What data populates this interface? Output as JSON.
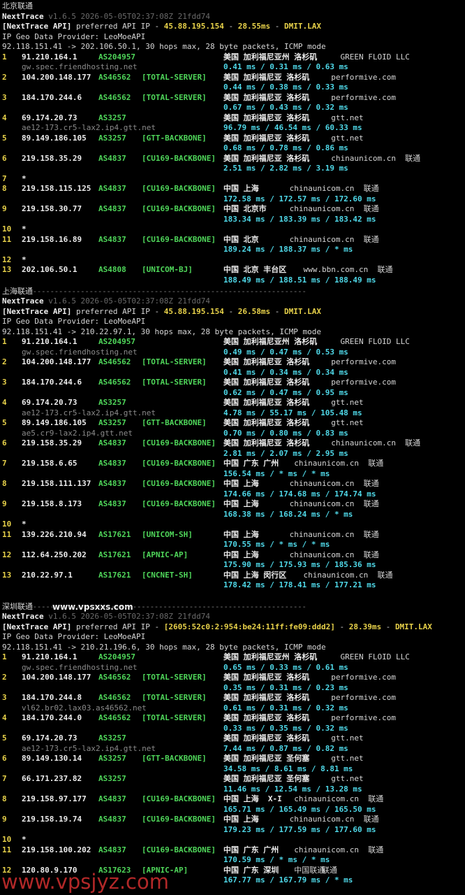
{
  "watermark": "www.vpsjyz.com",
  "sections": [
    {
      "title": "北京联通",
      "site": "",
      "version_line": "v1.6.5 2026-05-05T02:37:08Z 21fdd74",
      "app": "NextTrace",
      "api_label": "[NextTrace API]",
      "api_mid": "preferred API IP - ",
      "api_ip": "45.88.195.154",
      "api_sep": " - ",
      "api_ms": "28.55ms",
      "api_dc": "DMIT.LAX",
      "geo_line": "IP Geo Data Provider: LeoMoeAPI",
      "route_line": "92.118.151.41 -> 202.106.50.1, 30 hops max, 28 byte packets, ICMP mode",
      "hops": [
        {
          "num": "1",
          "ip": "91.210.164.1",
          "asn": "AS204957",
          "tag": "",
          "geo": "美国 加利福尼亚州 洛杉矶",
          "domain": "GREEN FLOID LLC",
          "isp": "",
          "rdns": "gw.spec.friendhosting.net",
          "times": "0.41 ms / 0.31 ms / 0.63 ms"
        },
        {
          "num": "2",
          "ip": "104.200.148.177",
          "asn": "AS46562",
          "tag": "[TOTAL-SERVER]",
          "geo": "美国 加利福尼亚 洛杉矶",
          "domain": "performive.com",
          "isp": "",
          "rdns": "",
          "times": "0.44 ms / 0.38 ms / 0.33 ms"
        },
        {
          "num": "3",
          "ip": "184.170.244.6",
          "asn": "AS46562",
          "tag": "[TOTAL-SERVER]",
          "geo": "美国 加利福尼亚 洛杉矶",
          "domain": "performive.com",
          "isp": "",
          "rdns": "",
          "times": "0.67 ms / 0.43 ms / 0.32 ms"
        },
        {
          "num": "4",
          "ip": "69.174.20.73",
          "asn": "AS3257",
          "tag": "",
          "geo": "美国 加利福尼亚 洛杉矶",
          "domain": "gtt.net",
          "isp": "",
          "rdns": "ae12-173.cr5-lax2.ip4.gtt.net",
          "times": "96.79 ms / 46.54 ms / 60.33 ms"
        },
        {
          "num": "5",
          "ip": "89.149.186.105",
          "asn": "AS3257",
          "tag": "[GTT-BACKBONE]",
          "geo": "美国 加利福尼亚 洛杉矶",
          "domain": "gtt.net",
          "isp": "",
          "rdns": "",
          "times": "0.68 ms / 0.78 ms / 0.86 ms"
        },
        {
          "num": "6",
          "ip": "219.158.35.29",
          "asn": "AS4837",
          "tag": "[CU169-BACKBONE]",
          "geo": "美国 加利福尼亚 洛杉矶",
          "domain": "chinaunicom.cn",
          "isp": "联通",
          "rdns": "",
          "times": "2.51 ms / 2.82 ms / 3.19 ms"
        },
        {
          "num": "7",
          "star": "*"
        },
        {
          "num": "8",
          "ip": "219.158.115.125",
          "asn": "AS4837",
          "tag": "[CU169-BACKBONE]",
          "geo": "中国 上海",
          "domain": "chinaunicom.cn",
          "isp": "联通",
          "rdns": "",
          "times": "172.58 ms / 172.57 ms / 172.60 ms"
        },
        {
          "num": "9",
          "ip": "219.158.30.77",
          "asn": "AS4837",
          "tag": "[CU169-BACKBONE]",
          "geo": "中国 北京市",
          "domain": "chinaunicom.cn",
          "isp": "联通",
          "rdns": "",
          "times": "183.34 ms / 183.39 ms / 183.42 ms"
        },
        {
          "num": "10",
          "star": "*"
        },
        {
          "num": "11",
          "ip": "219.158.16.89",
          "asn": "AS4837",
          "tag": "[CU169-BACKBONE]",
          "geo": "中国 北京",
          "domain": "chinaunicom.cn",
          "isp": "联通",
          "rdns": "",
          "times": "189.24 ms / 188.37 ms / * ms"
        },
        {
          "num": "12",
          "star": "*"
        },
        {
          "num": "13",
          "ip": "202.106.50.1",
          "asn": "AS4808",
          "tag": "[UNICOM-BJ]",
          "geo": "中国 北京 丰台区",
          "domain": "www.bbn.com.cn",
          "isp": "联通",
          "rdns": "",
          "times": "188.49 ms / 188.51 ms / 188.49 ms"
        }
      ]
    },
    {
      "title": "上海联通",
      "site": "",
      "version_line": "v1.6.5 2026-05-05T02:37:08Z 21fdd74",
      "app": "NextTrace",
      "api_label": "[NextTrace API]",
      "api_mid": "preferred API IP - ",
      "api_ip": "45.88.195.154",
      "api_sep": " - ",
      "api_ms": "26.58ms",
      "api_dc": "DMIT.LAX",
      "geo_line": "IP Geo Data Provider: LeoMoeAPI",
      "route_line": "92.118.151.41 -> 210.22.97.1, 30 hops max, 28 byte packets, ICMP mode",
      "hops": [
        {
          "num": "1",
          "ip": "91.210.164.1",
          "asn": "AS204957",
          "tag": "",
          "geo": "美国 加利福尼亚州 洛杉矶",
          "domain": "GREEN FLOID LLC",
          "isp": "",
          "rdns": "gw.spec.friendhosting.net",
          "times": "0.49 ms / 0.47 ms / 0.53 ms"
        },
        {
          "num": "2",
          "ip": "104.200.148.177",
          "asn": "AS46562",
          "tag": "[TOTAL-SERVER]",
          "geo": "美国 加利福尼亚 洛杉矶",
          "domain": "performive.com",
          "isp": "",
          "rdns": "",
          "times": "0.41 ms / 0.34 ms / 0.34 ms"
        },
        {
          "num": "3",
          "ip": "184.170.244.6",
          "asn": "AS46562",
          "tag": "[TOTAL-SERVER]",
          "geo": "美国 加利福尼亚 洛杉矶",
          "domain": "performive.com",
          "isp": "",
          "rdns": "",
          "times": "0.62 ms / 0.47 ms / 0.95 ms"
        },
        {
          "num": "4",
          "ip": "69.174.20.73",
          "asn": "AS3257",
          "tag": "",
          "geo": "美国 加利福尼亚 洛杉矶",
          "domain": "gtt.net",
          "isp": "",
          "rdns": "ae12-173.cr5-lax2.ip4.gtt.net",
          "times": "4.78 ms / 55.17 ms / 105.48 ms"
        },
        {
          "num": "5",
          "ip": "89.149.186.105",
          "asn": "AS3257",
          "tag": "[GTT-BACKBONE]",
          "geo": "美国 加利福尼亚 洛杉矶",
          "domain": "gtt.net",
          "isp": "",
          "rdns": "ae5.cr9-lax2.ip4.gtt.net",
          "times": "0.70 ms / 0.80 ms / 0.83 ms"
        },
        {
          "num": "6",
          "ip": "219.158.35.29",
          "asn": "AS4837",
          "tag": "[CU169-BACKBONE]",
          "geo": "美国 加利福尼亚 洛杉矶",
          "domain": "chinaunicom.cn",
          "isp": "联通",
          "rdns": "",
          "times": "2.81 ms / 2.07 ms / 2.95 ms"
        },
        {
          "num": "7",
          "ip": "219.158.6.65",
          "asn": "AS4837",
          "tag": "[CU169-BACKBONE]",
          "geo": "中国 广东 广州",
          "domain": "chinaunicom.cn",
          "isp": "联通",
          "rdns": "",
          "times": "156.54 ms / * ms / * ms"
        },
        {
          "num": "8",
          "ip": "219.158.111.137",
          "asn": "AS4837",
          "tag": "[CU169-BACKBONE]",
          "geo": "中国 上海",
          "domain": "chinaunicom.cn",
          "isp": "联通",
          "rdns": "",
          "times": "174.66 ms / 174.68 ms / 174.74 ms"
        },
        {
          "num": "9",
          "ip": "219.158.8.173",
          "asn": "AS4837",
          "tag": "[CU169-BACKBONE]",
          "geo": "中国 上海",
          "domain": "chinaunicom.cn",
          "isp": "联通",
          "rdns": "",
          "times": "168.38 ms / 168.24 ms / * ms"
        },
        {
          "num": "10",
          "star": "*"
        },
        {
          "num": "11",
          "ip": "139.226.210.94",
          "asn": "AS17621",
          "tag": "[UNICOM-SH]",
          "geo": "中国 上海",
          "domain": "chinaunicom.cn",
          "isp": "联通",
          "rdns": "",
          "times": "170.55 ms / * ms / * ms"
        },
        {
          "num": "12",
          "ip": "112.64.250.202",
          "asn": "AS17621",
          "tag": "[APNIC-AP]",
          "geo": "中国 上海",
          "domain": "chinaunicom.cn",
          "isp": "联通",
          "rdns": "",
          "times": "175.90 ms / 175.93 ms / 185.36 ms"
        },
        {
          "num": "13",
          "ip": "210.22.97.1",
          "asn": "AS17621",
          "tag": "[CNCNET-SH]",
          "geo": "中国 上海 闵行区",
          "domain": "chinaunicom.cn",
          "isp": "联通",
          "rdns": "",
          "times": "178.42 ms / 178.41 ms / 177.21 ms"
        }
      ]
    },
    {
      "title": "深圳联通",
      "site": "www.vpsxxs.com",
      "version_line": "v1.6.5 2026-05-05T02:37:08Z 21fdd74",
      "app": "NextTrace",
      "api_label": "[NextTrace API]",
      "api_mid": "preferred API IP - ",
      "api_ip": "[2605:52c0:2:954:be24:11ff:fe09:ddd2]",
      "api_sep": " - ",
      "api_ms": "28.39ms",
      "api_dc": "DMIT.LAX",
      "geo_line": "IP Geo Data Provider: LeoMoeAPI",
      "route_line": "92.118.151.41 -> 210.21.196.6, 30 hops max, 28 byte packets, ICMP mode",
      "hops": [
        {
          "num": "1",
          "ip": "91.210.164.1",
          "asn": "AS204957",
          "tag": "",
          "geo": "美国 加利福尼亚州 洛杉矶",
          "domain": "GREEN FLOID LLC",
          "isp": "",
          "rdns": "gw.spec.friendhosting.net",
          "times": "0.65 ms / 0.33 ms / 0.61 ms"
        },
        {
          "num": "2",
          "ip": "104.200.148.177",
          "asn": "AS46562",
          "tag": "[TOTAL-SERVER]",
          "geo": "美国 加利福尼亚 洛杉矶",
          "domain": "performive.com",
          "isp": "",
          "rdns": "",
          "times": "0.35 ms / 0.31 ms / 0.23 ms"
        },
        {
          "num": "3",
          "ip": "184.170.244.8",
          "asn": "AS46562",
          "tag": "[TOTAL-SERVER]",
          "geo": "美国 加利福尼亚 洛杉矶",
          "domain": "performive.com",
          "isp": "",
          "rdns": "vl62.br02.lax03.as46562.net",
          "times": "0.61 ms / 0.31 ms / 0.32 ms"
        },
        {
          "num": "4",
          "ip": "184.170.244.0",
          "asn": "AS46562",
          "tag": "[TOTAL-SERVER]",
          "geo": "美国 加利福尼亚 洛杉矶",
          "domain": "performive.com",
          "isp": "",
          "rdns": "",
          "times": "0.33 ms / 0.35 ms / 0.32 ms"
        },
        {
          "num": "5",
          "ip": "69.174.20.73",
          "asn": "AS3257",
          "tag": "",
          "geo": "美国 加利福尼亚 洛杉矶",
          "domain": "gtt.net",
          "isp": "",
          "rdns": "ae12-173.cr5-lax2.ip4.gtt.net",
          "times": "7.44 ms / 0.87 ms / 0.82 ms"
        },
        {
          "num": "6",
          "ip": "89.149.130.14",
          "asn": "AS3257",
          "tag": "[GTT-BACKBONE]",
          "geo": "美国 加利福尼亚 圣何塞",
          "domain": "gtt.net",
          "isp": "",
          "rdns": "",
          "times": "34.58 ms / 8.61 ms / 8.81 ms"
        },
        {
          "num": "7",
          "ip": "66.171.237.82",
          "asn": "AS3257",
          "tag": "",
          "geo": "美国 加利福尼亚 圣何塞",
          "domain": "gtt.net",
          "isp": "",
          "rdns": "",
          "times": "11.46 ms / 12.54 ms / 13.28 ms"
        },
        {
          "num": "8",
          "ip": "219.158.97.177",
          "asn": "AS4837",
          "tag": "[CU169-BACKBONE]",
          "geo": "中国 上海  X-I",
          "domain": "chinaunicom.cn",
          "isp": "联通",
          "rdns": "",
          "times": "165.71 ms / 165.49 ms / 165.50 ms"
        },
        {
          "num": "9",
          "ip": "219.158.19.74",
          "asn": "AS4837",
          "tag": "[CU169-BACKBONE]",
          "geo": "中国 上海",
          "domain": "chinaunicom.cn",
          "isp": "联通",
          "rdns": "",
          "times": "179.23 ms / 177.59 ms / 177.60 ms"
        },
        {
          "num": "10",
          "star": "*"
        },
        {
          "num": "11",
          "ip": "219.158.100.202",
          "asn": "AS4837",
          "tag": "[CU169-BACKBONE]",
          "geo": "中国 广东 广州",
          "domain": "chinaunicom.cn",
          "isp": "联通",
          "rdns": "",
          "times": "170.59 ms / * ms / * ms"
        },
        {
          "num": "12",
          "ip": "120.80.9.170",
          "asn": "AS17623",
          "tag": "[APNIC-AP]",
          "geo": "中国 广东 深圳",
          "domain": "中国联通",
          "isp": "联通",
          "rdns": "",
          "times": "167.77 ms / 167.79 ms / * ms"
        }
      ]
    }
  ],
  "separator": "----------------------------------------------------------------------",
  "colors": {
    "background": "#000000",
    "text": "#d6d6d6",
    "ip": "#e8d24a",
    "asn": "#4fd65a",
    "latency": "#4fd8e8",
    "muted": "#8a8a8a",
    "watermark": "#d23030"
  }
}
